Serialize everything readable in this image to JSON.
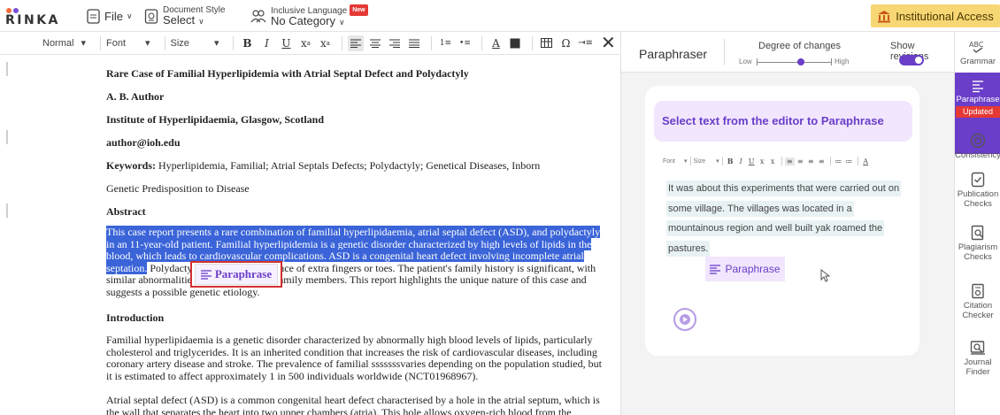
{
  "brand": {
    "name": "RINKA",
    "dot_colors": [
      "#f26b3a",
      "#7b4fd6"
    ]
  },
  "topbar": {
    "file_label": "File",
    "document_style_label": "Document Style",
    "document_style_value": "Select",
    "inclusive_language_label": "Inclusive Language",
    "inclusive_language_badge": "New",
    "inclusive_language_value": "No Category",
    "institutional_access_label": "Institutional Access"
  },
  "format_toolbar": {
    "style_value": "Normal",
    "font_value": "Font",
    "size_value": "Size"
  },
  "document": {
    "title": "Rare Case of Familial Hyperlipidemia with Atrial Septal Defect and Polydactyly",
    "author": "A. B. Author",
    "institution": "Institute of Hyperlipidaemia, Glasgow, Scotland",
    "email": "author@ioh.edu",
    "keywords_label": "Keywords:",
    "keywords_value": "Hyperlipidemia, Familial; Atrial Septals Defects; Polydactyly; Genetical Diseases, Inborn",
    "keywords_line2": "Genetic Predisposition to Disease",
    "abstract_heading": "Abstract",
    "abstract_selected": "This case report presents a rare combination of familial hyperlipidaemia, atrial septal defect (ASD), and polydactyly in an 11-year-old patient. Familial hyperlipidemia is a genetic disorder characterized by high levels of lipids in the blood, which leads to cardiovascular complications. ASD is a congenital heart defect involving incomplete atrial septation.",
    "abstract_rest": " Polydactyly refers to the presence of extra fingers or toes. The patient's family history is significant, with similar abnormalities observed in other family members. This report highlights the unique nature of this case and suggests a possible genetic etiology.",
    "introduction_heading": "Introduction",
    "introduction_text": "Familial hyperlipidaemia is a genetic disorder characterized by abnormally high blood levels of lipids, particularly cholesterol and triglycerides. It is an inherited condition that increases the risk of cardiovascular diseases, including coronary artery disease and stroke. The prevalence of familial sssssssvaries depending on the population studied, but it is estimated to affect approximately 1 in 500 individuals worldwide (NCT01968967).",
    "asd_text": "Atrial septal defect (ASD) is a common congenital heart defect characterised by a hole in the atrial septum, which is the wall that separates the heart into two upper chambers (atria). This hole allows oxygen-rich blood from the",
    "paraphrase_popup_label": "Paraphrase"
  },
  "paraphraser": {
    "title": "Paraphraser",
    "degree_label": "Degree of changes",
    "degree_low": "Low",
    "degree_high": "High",
    "degree_level": 0.6,
    "show_revisions_label": "Show revisions",
    "show_revisions_on": true,
    "card_header": "Select text from the editor to Paraphrase",
    "mini_font": "Font",
    "mini_size": "Size",
    "sample_text": "It was about this experiments that were carried out on some village. The villages was located in a mountainous region and well built yak roamed the pastures.",
    "paraphrase_button": "Paraphrase"
  },
  "sidebar": {
    "items": [
      {
        "label": "Grammar",
        "icon": "abc-check-icon"
      },
      {
        "label": "Paraphrase",
        "badge": "Updated",
        "icon": "paraphrase-icon"
      },
      {
        "label": "Consistency",
        "icon": "consistency-icon"
      },
      {
        "label": "Publication Checks",
        "icon": "publication-checks-icon"
      },
      {
        "label": "Plagiarism Checks",
        "icon": "plagiarism-icon"
      },
      {
        "label": "Citation Checker",
        "icon": "citation-icon"
      },
      {
        "label": "Journal Finder",
        "icon": "journal-finder-icon"
      }
    ]
  },
  "colors": {
    "accent": "#6a3ec9",
    "selection": "#3a64d8",
    "institutional": "#f7d774",
    "badge": "#e53935"
  }
}
